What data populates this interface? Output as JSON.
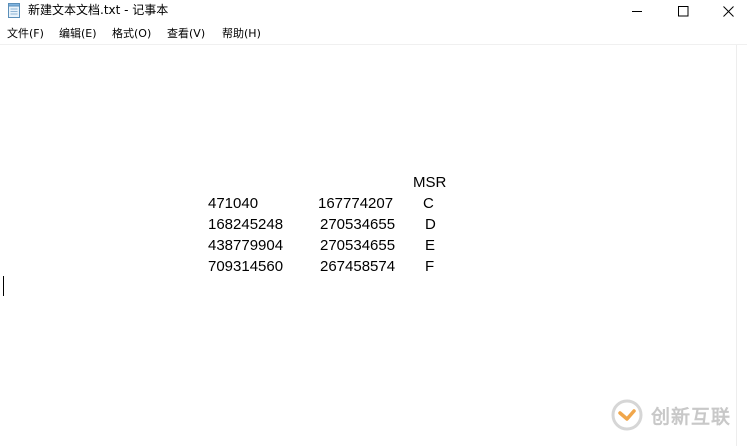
{
  "window": {
    "title": "新建文本文档.txt - 记事本",
    "controls": {
      "minimize": "minimize-icon",
      "maximize": "maximize-icon",
      "close": "close-icon"
    }
  },
  "menu": {
    "items": [
      {
        "label": "文件(F)"
      },
      {
        "label": "编辑(E)"
      },
      {
        "label": "格式(O)"
      },
      {
        "label": "查看(V)"
      },
      {
        "label": "帮助(H)"
      }
    ]
  },
  "document": {
    "header": "MSR",
    "rows": [
      {
        "col1": "471040",
        "col2": "167774207",
        "col3": "C"
      },
      {
        "col1": "168245248",
        "col2": "270534655",
        "col3": "D"
      },
      {
        "col1": "438779904",
        "col2": "270534655",
        "col3": "E"
      },
      {
        "col1": "709314560",
        "col2": "267458574",
        "col3": "F"
      }
    ]
  },
  "watermark": {
    "text": "创新互联",
    "color": "#c8c8c8",
    "accent": "#f0a64b"
  }
}
